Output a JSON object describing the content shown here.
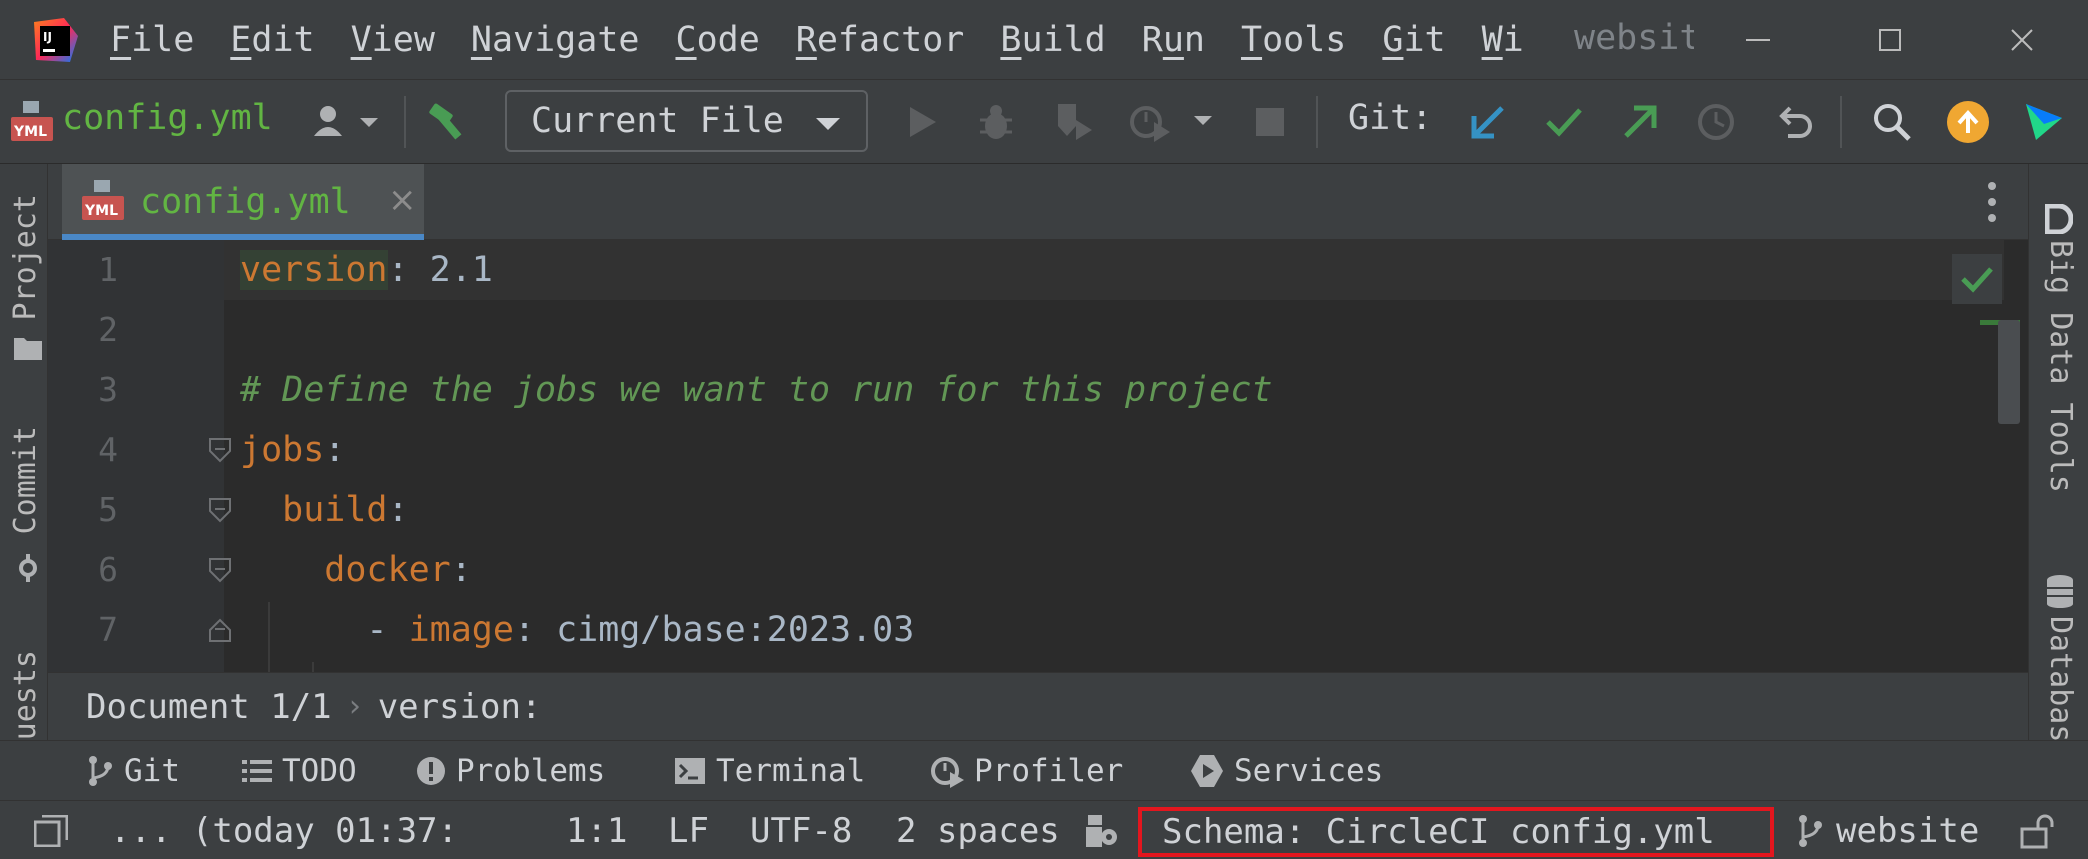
{
  "window": {
    "project_name": "website",
    "menu": [
      {
        "mnemonic": "F",
        "rest": "ile"
      },
      {
        "mnemonic": "E",
        "rest": "dit"
      },
      {
        "mnemonic": "V",
        "rest": "iew"
      },
      {
        "mnemonic": "N",
        "rest": "avigate"
      },
      {
        "mnemonic": "C",
        "rest": "ode"
      },
      {
        "mnemonic": "R",
        "rest": "efactor"
      },
      {
        "mnemonic": "B",
        "rest": "uild"
      },
      {
        "pre": "R",
        "mnemonic": "u",
        "rest": "n"
      },
      {
        "mnemonic": "T",
        "rest": "ools"
      },
      {
        "mnemonic": "G",
        "rest": "it"
      },
      {
        "mnemonic": "W",
        "rest": "i"
      }
    ]
  },
  "toolbar": {
    "current_file": "config.yml",
    "run_config": "Current File",
    "git_label": "Git:"
  },
  "tool_strips": {
    "left": [
      "Project",
      "Commit",
      "uests"
    ],
    "right": [
      "Big Data Tools",
      "Databas"
    ]
  },
  "editor": {
    "tab_label": "config.yml",
    "tab_close": "×",
    "lines": [
      {
        "no": "1",
        "parts": [
          {
            "t": "version",
            "cls": "k key-hl"
          },
          {
            "t": ": 2.1",
            "cls": "v"
          }
        ]
      },
      {
        "no": "2",
        "parts": []
      },
      {
        "no": "3",
        "parts": [
          {
            "t": "# Define the jobs we want to run for this project",
            "cls": "c"
          }
        ]
      },
      {
        "no": "4",
        "parts": [
          {
            "t": "jobs",
            "cls": "k"
          },
          {
            "t": ":",
            "cls": "v"
          }
        ]
      },
      {
        "no": "5",
        "parts": [
          {
            "t": "  build",
            "cls": "k"
          },
          {
            "t": ":",
            "cls": "v"
          }
        ]
      },
      {
        "no": "6",
        "parts": [
          {
            "t": "    docker",
            "cls": "k"
          },
          {
            "t": ":",
            "cls": "v"
          }
        ]
      },
      {
        "no": "7",
        "parts": [
          {
            "t": "      - ",
            "cls": "v"
          },
          {
            "t": "image",
            "cls": "k"
          },
          {
            "t": ": cimg/base:2023.03",
            "cls": "v"
          }
        ]
      }
    ]
  },
  "breadcrumb": {
    "doc": "Document 1/1",
    "sep": "›",
    "path": "version:"
  },
  "tool_windows": {
    "git": "Git",
    "todo": "TODO",
    "problems": "Problems",
    "terminal": "Terminal",
    "profiler": "Profiler",
    "services": "Services"
  },
  "status": {
    "vcs_info": "... (today 01:37:",
    "position": "1:1",
    "line_sep": "LF",
    "encoding": "UTF-8",
    "indent": "2 spaces",
    "schema": "Schema: CircleCI config.yml",
    "branch": "website"
  },
  "colors": {
    "accent_tab": "#4a88c7",
    "file_green": "#62b543",
    "keyword": "#cc7832",
    "comment": "#629755",
    "highlight_box": "#e3161e",
    "update_badge": "#f0a732"
  }
}
